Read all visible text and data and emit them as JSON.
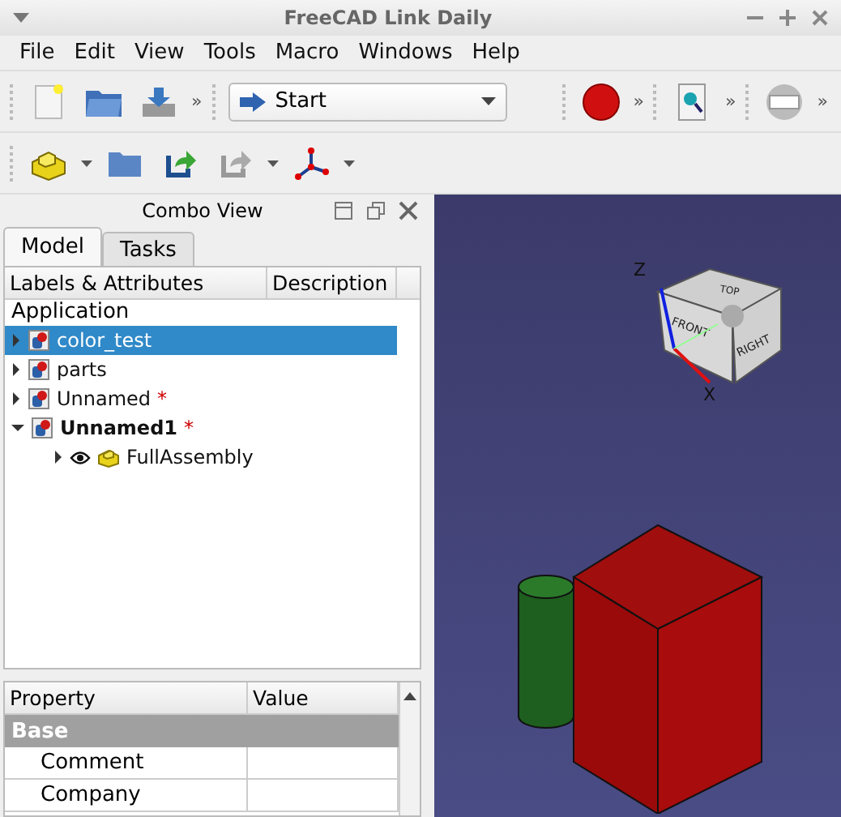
{
  "window": {
    "title": "FreeCAD Link Daily"
  },
  "menu": [
    "File",
    "Edit",
    "View",
    "Tools",
    "Macro",
    "Windows",
    "Help"
  ],
  "toolbar1": {
    "workbench": "Start",
    "more": "»"
  },
  "combo_view": {
    "title": "Combo View",
    "tabs": [
      {
        "label": "Model",
        "selected": true
      },
      {
        "label": "Tasks",
        "selected": false
      }
    ]
  },
  "tree": {
    "columns": [
      "Labels & Attributes",
      "Description"
    ],
    "root": "Application",
    "items": [
      {
        "label": "color_test",
        "selected": true,
        "expanded": false,
        "active": false
      },
      {
        "label": "parts",
        "selected": false,
        "expanded": false,
        "active": false
      },
      {
        "label": "Unnamed",
        "modified_mark": "*",
        "selected": false,
        "expanded": false,
        "active": false
      },
      {
        "label": "Unnamed1",
        "modified_mark": "*",
        "selected": false,
        "expanded": true,
        "active": true,
        "children": [
          {
            "label": "FullAssembly",
            "visible": true
          }
        ]
      }
    ]
  },
  "properties": {
    "columns": [
      "Property",
      "Value"
    ],
    "groups": [
      {
        "name": "Base",
        "rows": [
          "Comment",
          "Company"
        ]
      }
    ]
  },
  "viewport": {
    "axes": [
      "Z",
      "X"
    ],
    "faces": [
      "TOP",
      "FRONT",
      "RIGHT"
    ]
  }
}
